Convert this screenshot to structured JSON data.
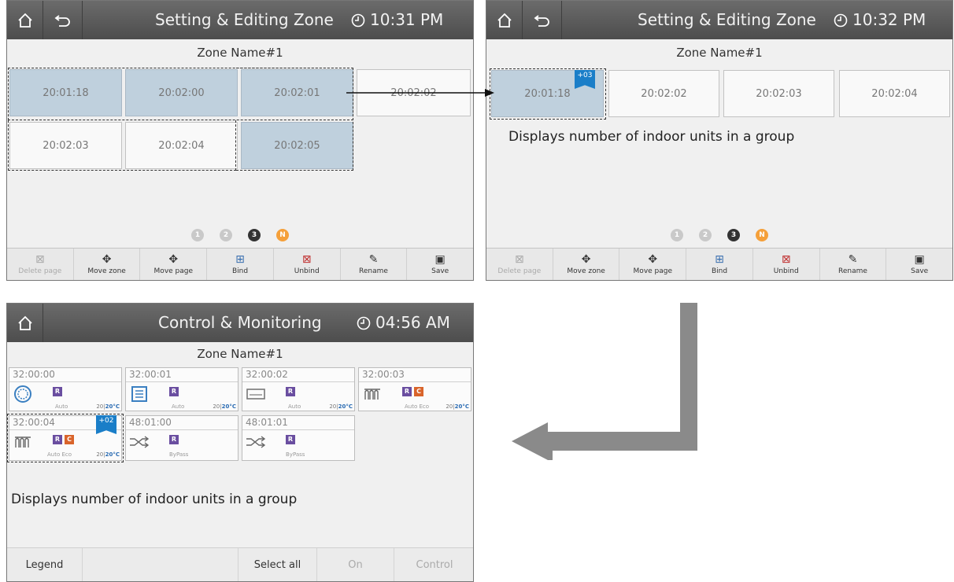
{
  "screen1": {
    "title": "Setting & Editing Zone",
    "time": "10:31 PM",
    "zone_name": "Zone Name#1",
    "tiles": [
      "20:01:18",
      "20:02:00",
      "20:02:01",
      "20:02:02",
      "20:02:03",
      "20:02:04",
      "20:02:05"
    ],
    "pages": [
      "1",
      "2",
      "3",
      "N"
    ],
    "toolbar": [
      "Delete page",
      "Move zone",
      "Move page",
      "Bind",
      "Unbind",
      "Rename",
      "Save"
    ]
  },
  "screen2": {
    "title": "Setting & Editing Zone",
    "time": "10:32 PM",
    "zone_name": "Zone Name#1",
    "tiles": [
      "20:01:18",
      "20:02:02",
      "20:02:03",
      "20:02:04"
    ],
    "badge": "+03",
    "note": "Displays number of indoor units in a group",
    "pages": [
      "1",
      "2",
      "3",
      "N"
    ],
    "toolbar": [
      "Delete page",
      "Move zone",
      "Move page",
      "Bind",
      "Unbind",
      "Rename",
      "Save"
    ]
  },
  "screen3": {
    "title": "Control & Monitoring",
    "time": "04:56 AM",
    "zone_name": "Zone Name#1",
    "units": [
      {
        "code": "32:00:00",
        "mode": "Auto",
        "set": "20",
        "cur": "20°C",
        "tags": [
          "R"
        ],
        "icon": "fan-icon"
      },
      {
        "code": "32:00:01",
        "mode": "Auto",
        "set": "20",
        "cur": "20°C",
        "tags": [
          "R"
        ],
        "icon": "cassette-icon"
      },
      {
        "code": "32:00:02",
        "mode": "Auto",
        "set": "20",
        "cur": "20°C",
        "tags": [
          "R"
        ],
        "icon": "wall-unit-icon"
      },
      {
        "code": "32:00:03",
        "mode": "Auto Eco",
        "set": "20",
        "cur": "20°C",
        "tags": [
          "R",
          "C"
        ],
        "icon": "heater-icon"
      },
      {
        "code": "32:00:04",
        "mode": "Auto Eco",
        "set": "20",
        "cur": "20°C",
        "tags": [
          "R",
          "C"
        ],
        "icon": "heater-icon"
      },
      {
        "code": "48:01:00",
        "mode": "ByPass",
        "tags": [
          "R"
        ],
        "icon": "bypass-icon"
      },
      {
        "code": "48:01:01",
        "mode": "ByPass",
        "tags": [
          "R"
        ],
        "icon": "bypass-icon"
      }
    ],
    "badge": "+02",
    "note": "Displays number of indoor units in a group",
    "bottom": {
      "legend": "Legend",
      "select_all": "Select all",
      "on": "On",
      "control": "Control"
    }
  }
}
